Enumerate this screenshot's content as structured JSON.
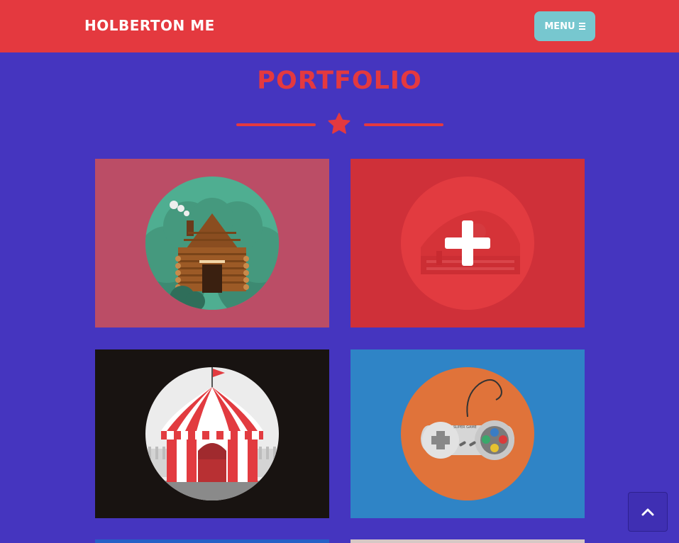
{
  "nav": {
    "brand": "HOLBERTON ME",
    "menu_label": "MENU",
    "menu_icon": "bars-icon"
  },
  "portfolio": {
    "title": "PORTFOLIO",
    "divider_icon": "star-icon",
    "items": [
      {
        "name": "log-cabin",
        "background": "#bb4d66",
        "icon": "log-cabin-illustration"
      },
      {
        "name": "cake",
        "background": "#cf3039",
        "icon": "cake-illustration",
        "overlay_icon": "plus-icon"
      },
      {
        "name": "circus-tent",
        "background": "#181311",
        "icon": "circus-tent-illustration"
      },
      {
        "name": "game-controller",
        "background": "#2f84c6",
        "icon": "game-controller-illustration",
        "controller_text": "SUPER GAME"
      }
    ]
  },
  "colors": {
    "page_background": "#4535bf",
    "accent": "#e4393f",
    "menu_button": "#77c7cf"
  },
  "scroll_top_icon": "chevron-up-icon"
}
